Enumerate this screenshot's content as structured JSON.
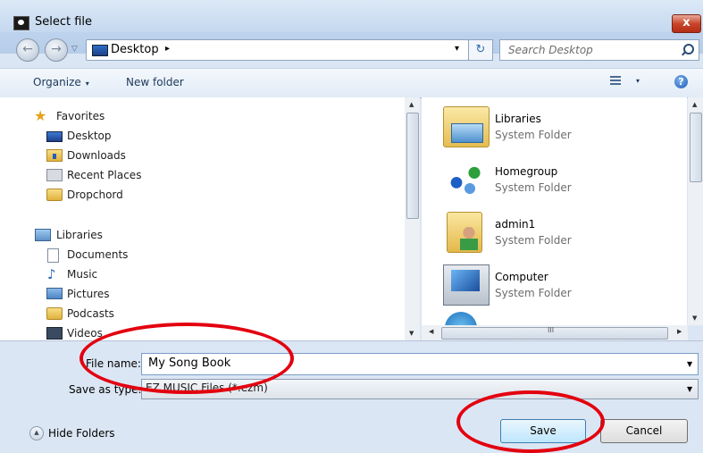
{
  "window": {
    "title": "Select file",
    "close_glyph": "x"
  },
  "nav": {
    "back_glyph": "←",
    "forward_glyph": "→",
    "recent_glyph": "▽",
    "address": "Desktop",
    "address_arrow": "▸",
    "address_drop": "▾",
    "refresh_glyph": "↻",
    "search_placeholder": "Search Desktop"
  },
  "toolbar": {
    "organize": "Organize",
    "new_folder": "New folder",
    "arrow": "▾",
    "help_glyph": "?"
  },
  "sidebar": {
    "favorites_label": "Favorites",
    "favorites": [
      "Desktop",
      "Downloads",
      "Recent Places",
      "Dropchord"
    ],
    "libraries_label": "Libraries",
    "libraries": [
      "Documents",
      "Music",
      "Pictures",
      "Podcasts",
      "Videos"
    ]
  },
  "content": {
    "items": [
      {
        "name": "Libraries",
        "type": "System Folder",
        "icon": "libraries-icon"
      },
      {
        "name": "Homegroup",
        "type": "System Folder",
        "icon": "homegroup-icon"
      },
      {
        "name": "admin1",
        "type": "System Folder",
        "icon": "user-folder-icon"
      },
      {
        "name": "Computer",
        "type": "System Folder",
        "icon": "computer-icon"
      }
    ],
    "hscroll_grip": "III"
  },
  "form": {
    "file_name_label": "File name:",
    "file_name_value": "My Song Book",
    "save_type_label": "Save as type:",
    "save_type_value": "EZ MUSIC Files (*.ezm)",
    "hide_folders": "Hide Folders",
    "save": "Save",
    "cancel": "Cancel"
  },
  "colors": {
    "accent": "#3c7fb1",
    "annotation": "#e3000f",
    "window_frame": "#c9dcf2"
  }
}
